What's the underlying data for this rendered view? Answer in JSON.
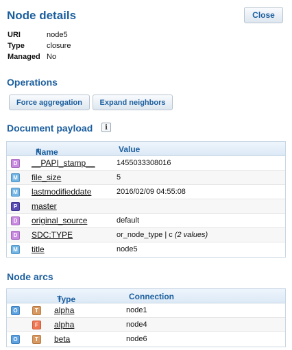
{
  "header": {
    "title": "Node details",
    "close_label": "Close"
  },
  "properties": [
    {
      "key": "URI",
      "value": "node5"
    },
    {
      "key": "Type",
      "value": "closure"
    },
    {
      "key": "Managed",
      "value": "No"
    }
  ],
  "operations": {
    "title": "Operations",
    "buttons": [
      "Force aggregation",
      "Expand neighbors"
    ]
  },
  "payload": {
    "title": "Document payload",
    "info_icon": "i",
    "columns": {
      "name": "Name",
      "value": "Value",
      "sort_glyph": "⬍"
    },
    "rows": [
      {
        "badge": "D",
        "name": "__PAPI_stamp__",
        "value": "1455033308016",
        "extra": ""
      },
      {
        "badge": "M",
        "name": "file_size",
        "value": "5",
        "extra": ""
      },
      {
        "badge": "M",
        "name": "lastmodifieddate",
        "value": "2016/02/09 04:55:08",
        "extra": ""
      },
      {
        "badge": "P",
        "name": "master",
        "value": "",
        "extra": ""
      },
      {
        "badge": "D",
        "name": "original_source",
        "value": "default",
        "extra": ""
      },
      {
        "badge": "D",
        "name": "SDC:TYPE",
        "value": "or_node_type | c ",
        "extra": "(2 values)"
      },
      {
        "badge": "M",
        "name": "title",
        "value": "node5",
        "extra": ""
      }
    ]
  },
  "arcs": {
    "title": "Node arcs",
    "columns": {
      "type": "Type",
      "connection": "Connection",
      "sort_glyph": "⬍"
    },
    "rows": [
      {
        "dir_badge": "O",
        "type_badge": "T",
        "type": "alpha",
        "connection": "node1"
      },
      {
        "dir_badge": "",
        "type_badge": "F",
        "type": "alpha",
        "connection": "node4"
      },
      {
        "dir_badge": "O",
        "type_badge": "T",
        "type": "beta",
        "connection": "node6"
      }
    ]
  },
  "colors": {
    "heading": "#1b5e9e",
    "badge_D": "#c88be0",
    "badge_M": "#72b4e4",
    "badge_P": "#5a4fb2",
    "badge_O": "#5fa2e0",
    "badge_T": "#d89a62",
    "badge_F": "#ee7653"
  }
}
